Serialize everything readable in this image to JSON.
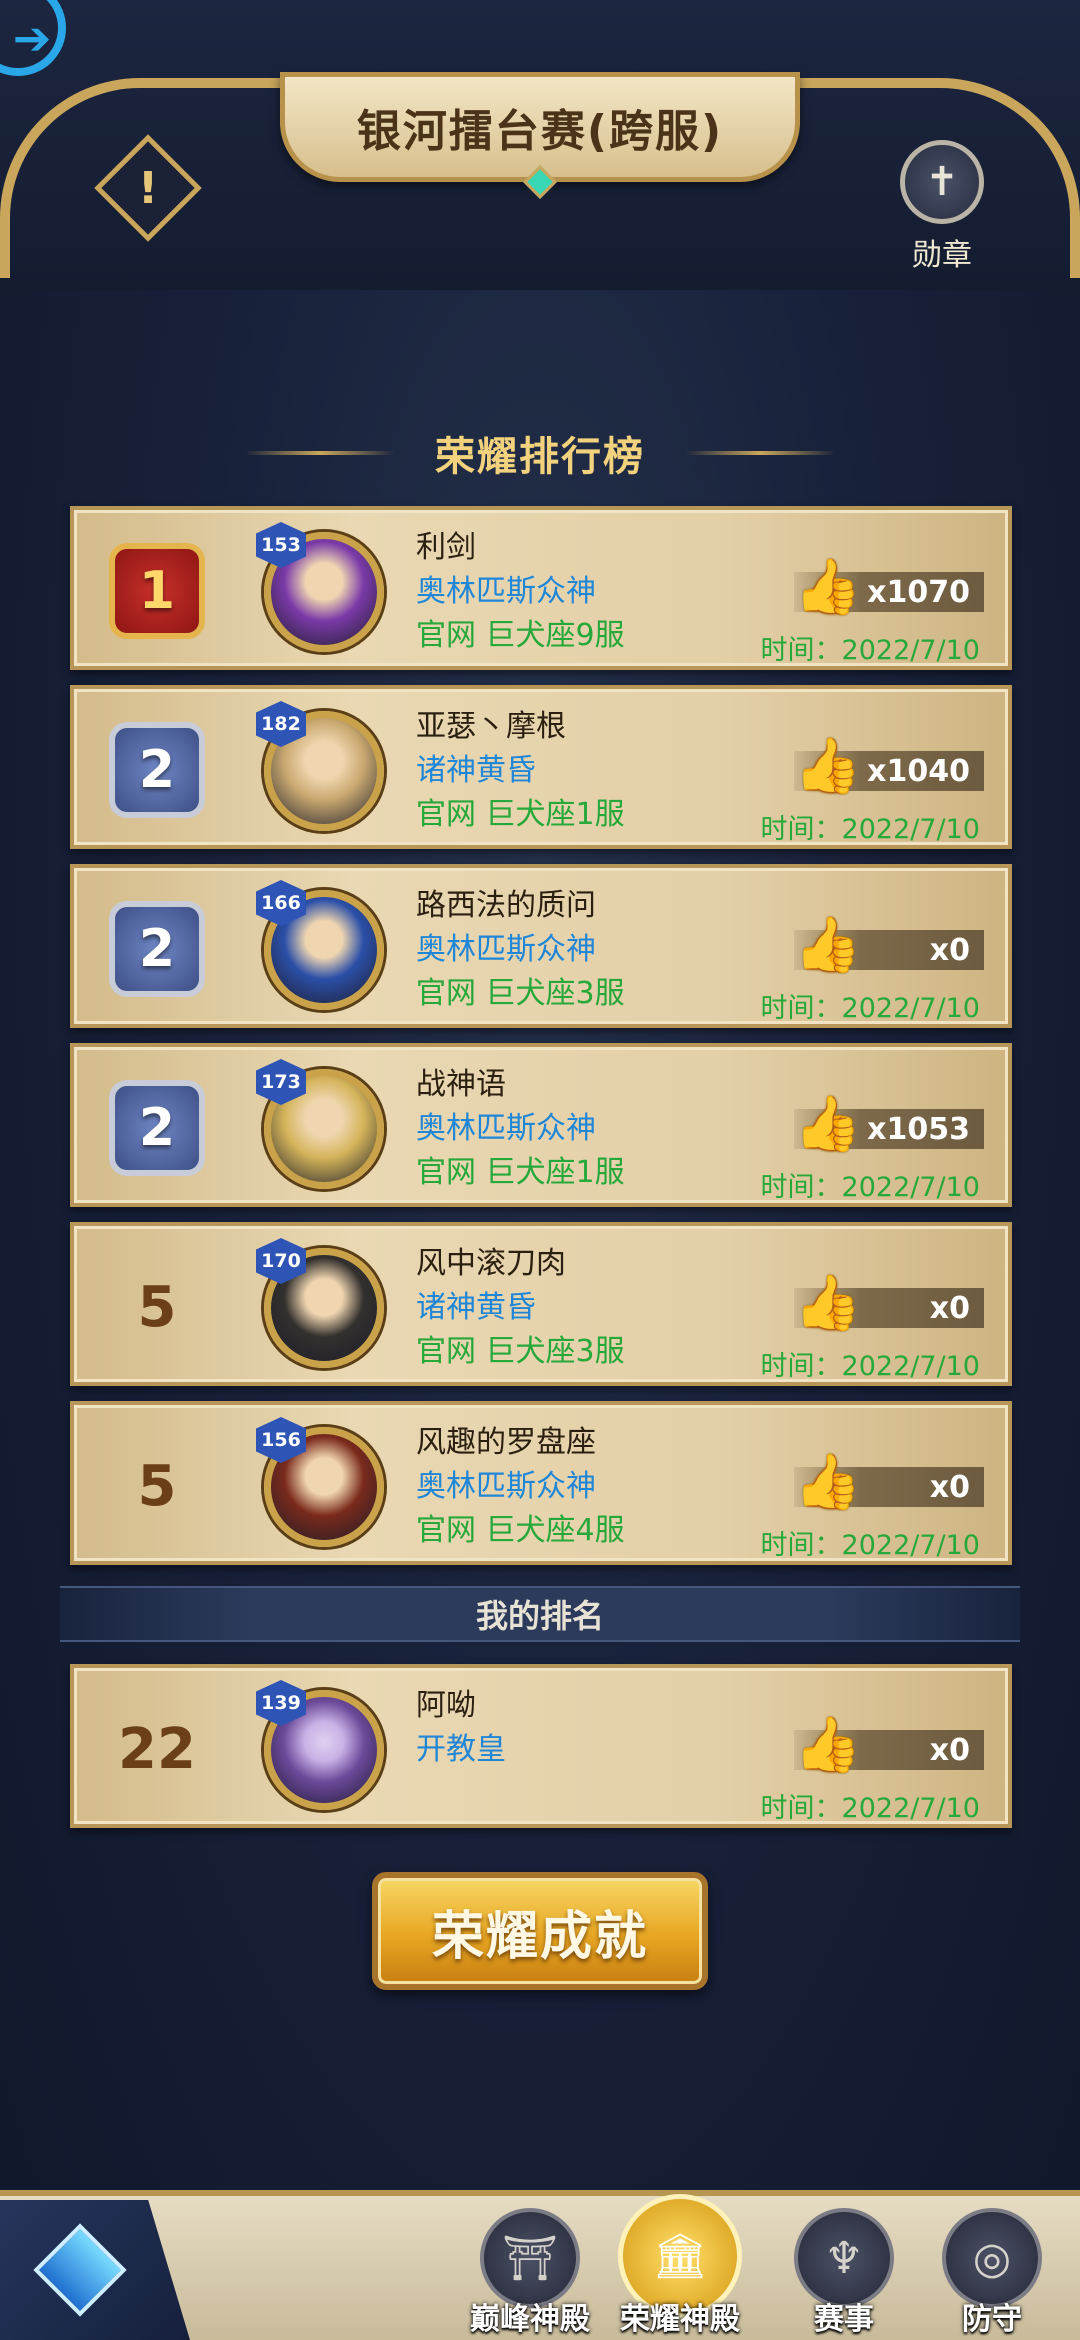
{
  "header": {
    "title": "银河擂台赛(跨服)",
    "info_icon": "!",
    "medal_label": "勋章"
  },
  "section_title": "荣耀排行榜",
  "time_prefix": "时间：",
  "rankings": [
    {
      "rank": "1",
      "rank_style": "gold",
      "level": "153",
      "name": "利剑",
      "guild": "奥林匹斯众神",
      "server": "官网 巨犬座9服",
      "likes": "x1070",
      "time": "2022/7/10"
    },
    {
      "rank": "2",
      "rank_style": "silver",
      "level": "182",
      "name": "亚瑟丶摩根",
      "guild": "诸神黄昏",
      "server": "官网 巨犬座1服",
      "likes": "x1040",
      "time": "2022/7/10"
    },
    {
      "rank": "2",
      "rank_style": "silver",
      "level": "166",
      "name": "路西法的质问",
      "guild": "奥林匹斯众神",
      "server": "官网 巨犬座3服",
      "likes": "x0",
      "time": "2022/7/10"
    },
    {
      "rank": "2",
      "rank_style": "silver",
      "level": "173",
      "name": "战神语",
      "guild": "奥林匹斯众神",
      "server": "官网 巨犬座1服",
      "likes": "x1053",
      "time": "2022/7/10"
    },
    {
      "rank": "5",
      "rank_style": "plain",
      "level": "170",
      "name": "风中滚刀肉",
      "guild": "诸神黄昏",
      "server": "官网 巨犬座3服",
      "likes": "x0",
      "time": "2022/7/10"
    },
    {
      "rank": "5",
      "rank_style": "plain",
      "level": "156",
      "name": "风趣的罗盘座",
      "guild": "奥林匹斯众神",
      "server": "官网 巨犬座4服",
      "likes": "x0",
      "time": "2022/7/10"
    }
  ],
  "my_rank": {
    "heading": "我的排名",
    "rank": "22",
    "level": "139",
    "name": "阿呦",
    "guild": "开教皇",
    "likes": "x0",
    "time": "2022/7/10"
  },
  "achievement_button": "荣耀成就",
  "nav": {
    "items": [
      {
        "label": "巅峰神殿",
        "icon": "temple-icon",
        "active": false
      },
      {
        "label": "荣耀神殿",
        "icon": "glory-temple-icon",
        "active": true
      },
      {
        "label": "赛事",
        "icon": "trident-icon",
        "active": false
      },
      {
        "label": "防守",
        "icon": "shield-icon",
        "active": false
      }
    ]
  },
  "colors": {
    "gold": "#c9a65c",
    "guild_blue": "#1f86d8",
    "server_green": "#27a83a",
    "thumb_yellow": "#f2c11a"
  },
  "avatar_colors": [
    "#7a3aa8",
    "#c9a870",
    "#2b4fa8",
    "#d4b45a",
    "#33302e",
    "#7a2a1c"
  ],
  "my_avatar_color": "#6b4a9a"
}
